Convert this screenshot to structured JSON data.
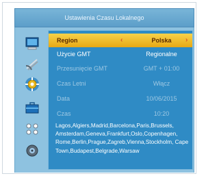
{
  "title": "Ustawienia Czasu Lokalnego",
  "sidebar": {
    "icons": [
      "monitor-icon",
      "satellite-dish-icon",
      "settings-gear-icon",
      "briefcase-icon",
      "network-nodes-icon",
      "disc-icon"
    ]
  },
  "settings": [
    {
      "label": "Region",
      "value": "Polska",
      "state": "selected"
    },
    {
      "label": "Użycie GMT",
      "value": "Regionalne",
      "state": "active"
    },
    {
      "label": "Przesunięcie GMT",
      "value": "GMT + 01:00",
      "state": "dim"
    },
    {
      "label": "Czas Letni",
      "value": "Włącz",
      "state": "dim"
    },
    {
      "label": "Data",
      "value": "10/06/2015",
      "state": "dim"
    },
    {
      "label": "Czas",
      "value": "10:20",
      "state": "dim"
    }
  ],
  "cities": "Lagos,Algiers,Madrid,Barcelona,Paris,Brussels, Amsterdam,Geneva,Frankfurt,Oslo,Copenhagen, Rome,Berlin,Prague,Zagreb,Vienna,Stockholm, Cape Town,Budapest,Belgrade,Warsaw",
  "colors": {
    "panel": "#8ec2e0",
    "content": "#2f8bc5",
    "highlight": "#f2c234"
  }
}
